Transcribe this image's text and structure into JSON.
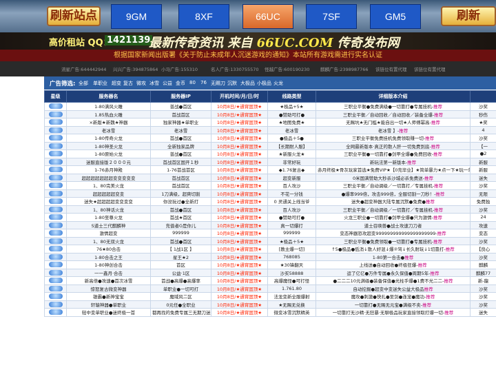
{
  "banner": {
    "refresh_left": "刷新站点",
    "refresh_right": "刷新",
    "sites": [
      "9GM",
      "8XF",
      "66UC",
      "7SF",
      "GM5"
    ],
    "active_site": "66UC"
  },
  "contact": {
    "qq_label": "高价租站 QQ：",
    "qq_number": "1421139",
    "slogan_a": "最新传奇资讯 来自",
    "slogan_site": "66UC.COM",
    "slogan_b": "传奇发布网"
  },
  "notice": "根据国家新闻出版署《关于防止未成年人沉迷游戏的通知》本站所有游戏需进行实名认证",
  "ads": [
    "流星广告:644442944",
    "兴兴广告:394875864",
    "小马广告:155310",
    "名人广告:1330755570",
    "怪越广告:600190230",
    "麒麟广告:2398987766",
    "该链位有置代理",
    "该链位有置代理"
  ],
  "filters": {
    "label": "广告筛选:",
    "items": [
      "全部",
      "单职业",
      "超变",
      "复古",
      "微攻",
      "冰雪",
      "公益",
      "金币",
      "80",
      "76",
      "无赐刀",
      "沉默",
      "大极品",
      "小极品",
      "火龙"
    ]
  },
  "table": {
    "headers": [
      "星级",
      "服务器名",
      "服务器IP",
      "开机时间/月/日/时",
      "线路类型",
      "详细版本介绍",
      ""
    ],
    "rows": [
      [
        "1-80满风火雕",
        "普战●首区",
        "10月8日/★通宵固顶★",
        "★极品+5★",
        "三职业平衡●免费满级●一切靠打●专属挂机-推荐",
        "沙奖"
      ],
      [
        "1.85热血火雕",
        "首战首区",
        "10月8日/★通宵固顶★",
        "●赞助可打●",
        "三职业平衡／自动回收／自动回收／装备全爆-推荐",
        "秒伤"
      ],
      [
        "×新版★新魏★神器",
        "独家神器★单职业",
        "10月8日/★通宵固顶★",
        "★地图免费★",
        "无赐坑★无门槛★能自出一切★人师傅幂高-推荐",
        "★奖"
      ],
      [
        "老冰雪",
        "老冰雪",
        "10月8日/★通宵固顶★",
        "老冰雪",
        "老冰雪 】-推荐",
        "4"
      ],
      [
        "1-80传奇火龙",
        "首战●首区",
        "10月8日/★通宵固顶★",
        "●极品＋5●",
        "三职业平衡免费挂机免费领取赚一切-推荐",
        "沙奖"
      ],
      [
        "1-80神圣火龙",
        "全新独家品牌",
        "10月8日/★通宵固顶★",
        "【长期耐人服】",
        "全网最新版本·真正的散人肝·一切免费到底-推荐",
        "【一"
      ],
      [
        "1-80原始火龙",
        "普战●首区",
        "10月8日/★通宵固顶★",
        "★新服火龙★",
        "三职业平衡●一切靠打●剑甲全爆●免费回收-推荐",
        "●2"
      ],
      [
        "迷服直接版２０００元",
        "首战首区国开１秒",
        "10月8日/★通宵固顶★",
        "非常好玩",
        "新玩法第一新版本-推荐",
        "新服"
      ],
      [
        "1-76赤月神殿",
        "1-76首战首区",
        "10月8日/★通宵固顶★",
        "◆1.76复古◆",
        "赤月终极★骨灰玩家首选★免费VIP★【0充毕业】★简单暴力★点一下★玩一年",
        "新服"
      ],
      [
        "超超超超超超超变变变变变",
        "首战首区",
        "10月8日/★通宵固顶★",
        "超变新服",
        "0米国满赞助大秒杀沙城必杀免费送-推荐",
        "迷失"
      ],
      [
        "1、80完美火龙",
        "首战首区",
        "10月8日/★通宵固顶★",
        "百人攻沙",
        "三职业平衡／自动调级／一切靠打／专属挂机-推荐",
        "沙奖"
      ],
      [
        "超超超超超变变",
        "1刀满级，超爽切割",
        "10月8日/★通宵固顶★",
        "不花一分钱",
        "●爆率999倍，攻击999倍，全服切割一刀秒！-推荐",
        "无限"
      ],
      [
        "迷失★超超超超变变变变",
        "你没玩过●全新打",
        "10月8日/★通宵固顶★",
        "0 灵通关上线当爷",
        "迷失●超变神器大陆专属沉默●免费●推荐",
        "免费独"
      ],
      [
        "1、80神话火龙",
        "首战●首区",
        "10月8日/★通宵固顶★",
        "百人攻沙",
        "三职业平衡／自动调级／一切靠打／专属挂机-推荐",
        "沙奖"
      ],
      [
        "1-80至尊火龙",
        "首战★首区",
        "10月8日/★通宵固顶★",
        "●赞助可打●",
        "火龙三职业●一切靠打●剑甲全爆●只为激情-推荐",
        "24"
      ],
      [
        "S道士三代麒麟神",
        "充值者G是你儿",
        "10月8日/★通宵固顶★",
        "真一切爆打",
        "道士召唤兽●战士攻速刀刀者",
        "攻速"
      ],
      [
        "激情超变",
        "999999",
        "10月8日/★通宵固顶★",
        "999999",
        "变态神器恐攻超变999999999999999999999-推荐",
        "变态"
      ],
      [
        "1、80无双火龙",
        "首战●首区",
        "10月8日/★通宵固顶★",
        "★极品＋5★",
        "三职业平衡●免费领取●一切靠打●专属挂机-推荐",
        "沙奖"
      ],
      [
        "76★80合击",
        "【 1战1区 】",
        "10月8日/★通宵固顶★",
        "[教主爆一切]",
        "↑5●极品●低消↓散人好混↓爆②驾↓长久耐玩↓1切靠打-推荐",
        "【良心"
      ],
      [
        "1-80合击之王",
        "星王★2",
        "10月8日/★通宵固顶★",
        "768085",
        "1-80第一合击●推荐",
        "沙奖"
      ],
      [
        "1-80神创合击",
        "首区",
        "10月8日/★通宵固顶★",
        "★30锋翻天",
        "上线送●自动回收●终极狂爆-推荐",
        "麒麟"
      ],
      [
        "一一鑫月·合击",
        "公益·1区",
        "10月8日/★通宵固顶★",
        "沙买58888",
        "运了亿亿●万件专属●永久保值●周期5年-推荐",
        "麒麟77"
      ],
      [
        "新高倍●攻速●首次冰雪",
        "首战●高爆●高爆率",
        "10月8日/★通宵固顶★",
        "高爆魔怪●可打怪",
        "●二二二10元满级●装备保值●光柱手爆●1费不光二二-推荐",
        "新-龍"
      ],
      [
        "惊怒复古微变神器",
        "单职业●一切可打",
        "10月8日/★通宵固顶★",
        "1.761.80",
        "自动挖掘●超变中变迷失公益大极品推荐",
        "沙奖"
      ],
      [
        "雄霸●新神宝宝",
        "魔域风二区",
        "10月8日/★通宵固顶★",
        "法龙变新全服爆射",
        "魔攻●刺激●快扎●至剑●连宠●魔功-推荐",
        "沙奖"
      ],
      [
        "轩辕神器●单职业",
        "0元任●全职业",
        "10月8日/★通宵固顶★",
        "★无赐无兑换",
        "一切靠打●无赐无元宝●满级不卖-推荐",
        "沙奖"
      ],
      [
        "轻中变单职业●迷终极一首",
        "都再找的免费专属三无期刀迷失",
        "10月8日/★通宵固顶★",
        "微变冰雪沉默精英",
        "一切靠打无沙精·无狂暴·无聊极品玩家直接领取打爆一切-推荐",
        "迷失"
      ]
    ]
  },
  "colors": {
    "header_bg": "#1e3f7a",
    "time_text": "#ff2200",
    "recommend": "#c80080",
    "filter_bar": "#2d5fa2",
    "notice_bg": "#6b1010"
  }
}
